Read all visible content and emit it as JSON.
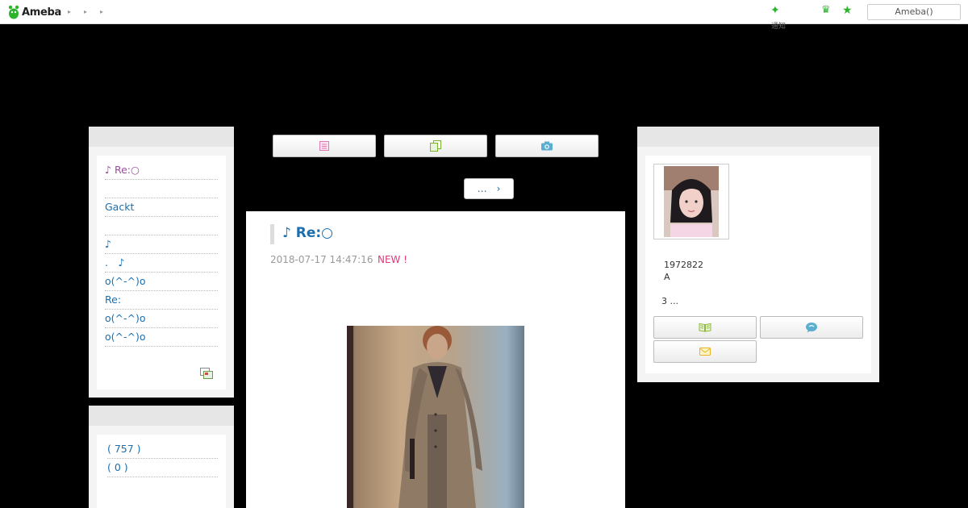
{
  "header": {
    "logo_text": "Ameba",
    "breadcrumbs": [
      "▸",
      "▸",
      "▸"
    ],
    "notification_label": "通知",
    "account_button": "Ameba()"
  },
  "left_sidebar": {
    "recent_entries": [
      "♪ Re:○",
      "",
      "Gackt",
      "",
      "♪",
      ".　♪",
      "o(^-^)o",
      "Re:",
      "o(^-^)o",
      "o(^-^)o"
    ],
    "themes": [
      "( 757 )",
      "( 0 )"
    ]
  },
  "toolbar": {
    "more_label": "…　›"
  },
  "article": {
    "title": "♪ Re:○",
    "date": "2018-07-17 14:47:16",
    "new_badge": "NEW !"
  },
  "profile": {
    "line1": "1972822",
    "line2": "A",
    "line3": "3 ..."
  },
  "colors": {
    "accent_blue": "#1a6fb0",
    "new_pink": "#e0377a",
    "ameba_green": "#2db42d"
  }
}
